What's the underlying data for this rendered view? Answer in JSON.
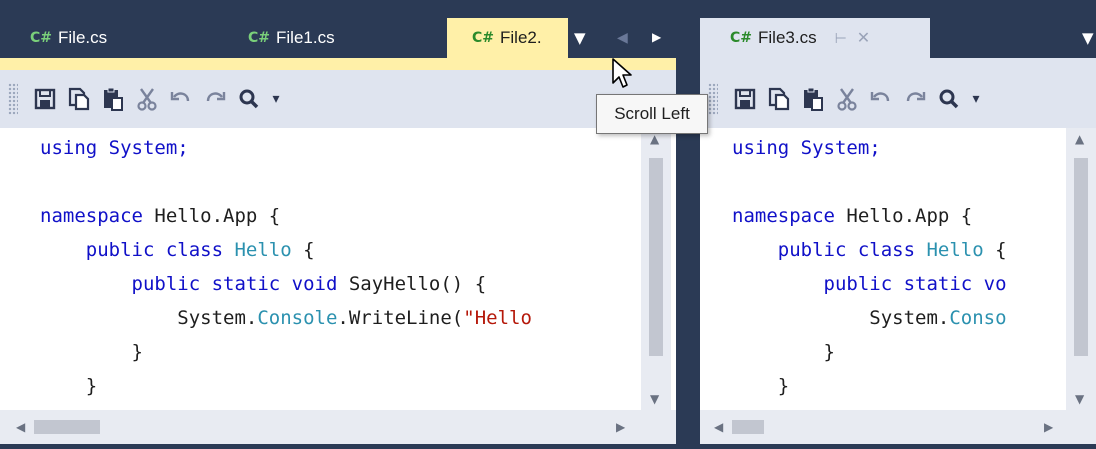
{
  "tabs_left": [
    {
      "label": "File.cs",
      "icon": "csharp-file-icon"
    },
    {
      "label": "File1.cs",
      "icon": "csharp-file-icon"
    },
    {
      "label": "File2.",
      "icon": "csharp-file-icon",
      "active": true
    }
  ],
  "tabs_right": [
    {
      "label": "File3.cs",
      "icon": "csharp-file-icon",
      "active": true
    }
  ],
  "tab_icon_text": "C#",
  "tooltip": "Scroll Left",
  "colors": {
    "background": "#2b3a55",
    "active_tab": "#fff0a8",
    "toolbar": "#dfe4ef",
    "keyword": "#1010c8",
    "type": "#2b91af",
    "string": "#b5180a"
  },
  "code_left": {
    "l1": "using System;",
    "l3a": "namespace ",
    "l3b": "Hello.App {",
    "l4a": "    public class ",
    "l4b": "Hello",
    "l4c": " {",
    "l5a": "        public static void ",
    "l5b": "SayHello() {",
    "l6a": "            System.",
    "l6b": "Console",
    "l6c": ".WriteLine(",
    "l6d": "\"Hello",
    "l7": "        }",
    "l8": "    }",
    "l9": "}"
  },
  "code_right": {
    "l1": "using System;",
    "l3a": "namespace ",
    "l3b": "Hello.App {",
    "l4a": "    public class ",
    "l4b": "Hello",
    "l4c": " {",
    "l5a": "        public static vo",
    "l6a": "            System.",
    "l6b": "Conso",
    "l7": "        }",
    "l8": "    }",
    "l9": "}"
  }
}
